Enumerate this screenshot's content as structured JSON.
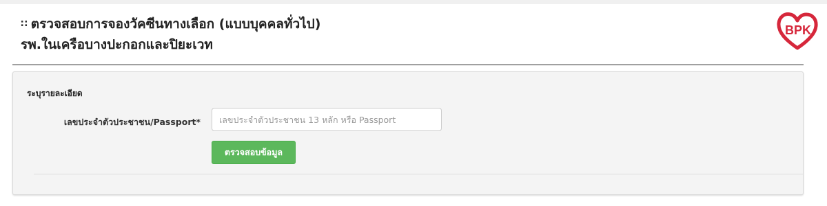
{
  "header": {
    "title_line1": "ตรวจสอบการจองวัคซีนทางเลือก (แบบบุคคลทั่วไป)",
    "title_line2": "รพ.ในเครือบางปะกอกและปิยะเวท",
    "logo_text": "BPK",
    "title_icon_glyph": "∷"
  },
  "form": {
    "heading": "ระบุรายละเอียด",
    "id_label": "เลขประจำตัวประชาชน/Passport*",
    "id_value": "",
    "id_placeholder": "เลขประจำตัวประชาชน 13 หลัก หรือ Passport",
    "submit_label": "ตรวจสอบข้อมูล"
  },
  "colors": {
    "brand_red": "#d6273b",
    "button_green": "#5cb85c",
    "panel_bg": "#f4f4f4"
  },
  "icons": {
    "title_icon": "grid-dots-icon",
    "logo": "bpk-heart-logo"
  }
}
